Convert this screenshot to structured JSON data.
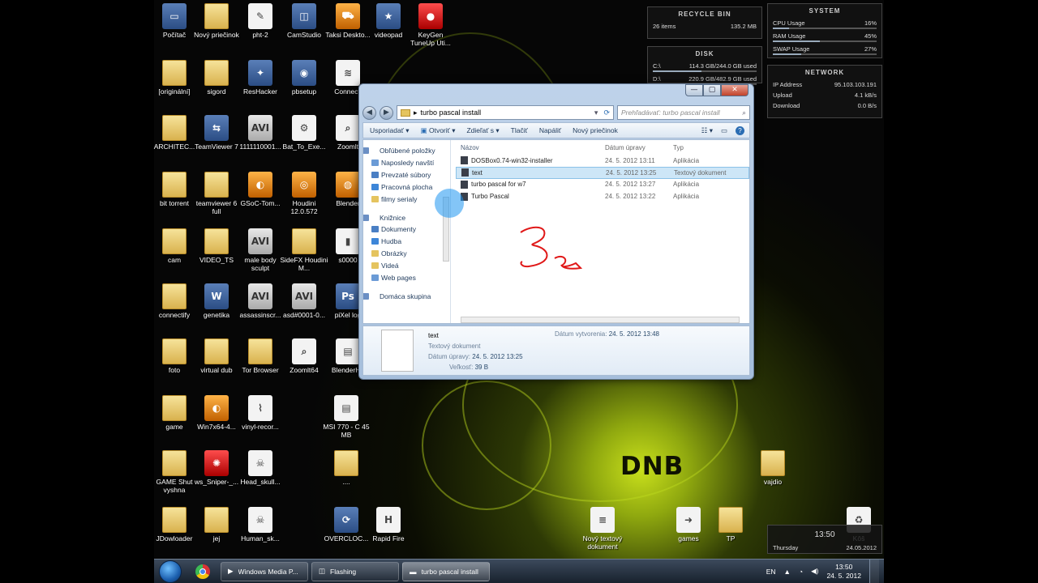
{
  "desktop": {
    "brand_text": "DNB",
    "icons": [
      {
        "label": "Počítač",
        "kind": "app",
        "glyph": "▭"
      },
      {
        "label": "Nový priečinok",
        "kind": "folder",
        "glyph": ""
      },
      {
        "label": "pht-2",
        "kind": "white",
        "glyph": "✎"
      },
      {
        "label": "CamStudio",
        "kind": "app",
        "glyph": "◫"
      },
      {
        "label": "Taksi Deskto...",
        "kind": "orange",
        "glyph": "⛟"
      },
      {
        "label": "videopad",
        "kind": "app",
        "glyph": "★"
      },
      {
        "label": "KeyGen TuneUp Uti...",
        "kind": "red",
        "glyph": "●"
      },
      {
        "label": "[originální]",
        "kind": "folder",
        "glyph": ""
      },
      {
        "label": "sigord",
        "kind": "folder",
        "glyph": ""
      },
      {
        "label": "ResHacker",
        "kind": "app",
        "glyph": "✦"
      },
      {
        "label": "pbsetup",
        "kind": "app",
        "glyph": "◉"
      },
      {
        "label": "Connecti",
        "kind": "white",
        "glyph": "≋"
      },
      {
        "label": "ARCHITEC...",
        "kind": "folder",
        "glyph": ""
      },
      {
        "label": "TeamViewer 7",
        "kind": "app",
        "glyph": "⇆"
      },
      {
        "label": "1111110001...",
        "kind": "film",
        "glyph": "AVI"
      },
      {
        "label": "Bat_To_Exe...",
        "kind": "white",
        "glyph": "⚙"
      },
      {
        "label": "Zoomlt",
        "kind": "white",
        "glyph": "⌕"
      },
      {
        "label": "bit torrent",
        "kind": "folder",
        "glyph": ""
      },
      {
        "label": "teamviewer 6 full",
        "kind": "folder",
        "glyph": ""
      },
      {
        "label": "GSoC-Tom...",
        "kind": "orange",
        "glyph": "◐"
      },
      {
        "label": "Houdini 12.0.572",
        "kind": "orange",
        "glyph": "◎"
      },
      {
        "label": "Blender",
        "kind": "orange",
        "glyph": "◍"
      },
      {
        "label": "cam",
        "kind": "folder",
        "glyph": ""
      },
      {
        "label": "VIDEO_TS",
        "kind": "folder",
        "glyph": ""
      },
      {
        "label": "male body sculpt",
        "kind": "film",
        "glyph": "AVI"
      },
      {
        "label": "SideFX Houdini M...",
        "kind": "folder",
        "glyph": ""
      },
      {
        "label": "s0000",
        "kind": "white",
        "glyph": "▮"
      },
      {
        "label": "connectify",
        "kind": "folder",
        "glyph": ""
      },
      {
        "label": "genetika",
        "kind": "app",
        "glyph": "W"
      },
      {
        "label": "assassinscr...",
        "kind": "film",
        "glyph": "AVI"
      },
      {
        "label": "asd#0001-0...",
        "kind": "film",
        "glyph": "AVI"
      },
      {
        "label": "piXel log",
        "kind": "app",
        "glyph": "Ps"
      },
      {
        "label": "foto",
        "kind": "folder",
        "glyph": ""
      },
      {
        "label": "virtual dub",
        "kind": "folder",
        "glyph": ""
      },
      {
        "label": "Tor Browser",
        "kind": "folder",
        "glyph": ""
      },
      {
        "label": "Zoomlt64",
        "kind": "white",
        "glyph": "⌕"
      },
      {
        "label": "BlenderHe",
        "kind": "white",
        "glyph": "▤"
      },
      {
        "label": "game",
        "kind": "folder",
        "glyph": ""
      },
      {
        "label": "Win7x64-4...",
        "kind": "orange",
        "glyph": "◐"
      },
      {
        "label": "vinyl-recor...",
        "kind": "white",
        "glyph": "⌇"
      },
      {
        "label": "MSI 770 - C 45 MB",
        "kind": "white",
        "glyph": "▤"
      },
      {
        "label": "GAME Shut vyshna",
        "kind": "folder",
        "glyph": ""
      },
      {
        "label": "ws_Sniper-_...",
        "kind": "red",
        "glyph": "✺"
      },
      {
        "label": "Head_skull...",
        "kind": "white",
        "glyph": "☠"
      },
      {
        "label": "....",
        "kind": "folder",
        "glyph": ""
      },
      {
        "label": "vajdio",
        "kind": "folder",
        "glyph": ""
      },
      {
        "label": "JDowloader",
        "kind": "folder",
        "glyph": ""
      },
      {
        "label": "jej",
        "kind": "folder",
        "glyph": ""
      },
      {
        "label": "Human_sk...",
        "kind": "white",
        "glyph": "☠"
      },
      {
        "label": "OVERCLOC...",
        "kind": "app",
        "glyph": "⟳"
      },
      {
        "label": "Rapid Fire",
        "kind": "white",
        "glyph": "H"
      },
      {
        "label": "Nový textový dokument",
        "kind": "white",
        "glyph": "≡"
      },
      {
        "label": "games",
        "kind": "white",
        "glyph": "➜"
      },
      {
        "label": "TP",
        "kind": "folder",
        "glyph": ""
      },
      {
        "label": "Kôš",
        "kind": "white",
        "glyph": "♻"
      }
    ]
  },
  "gadgets": {
    "recycle": {
      "title": "RECYCLE BIN",
      "items": "26 items",
      "size": "135.2 MB"
    },
    "disk": {
      "title": "DISK",
      "rows": [
        {
          "drive": "C:\\",
          "usage": "114.3 GB/244.0 GB used",
          "pct": 47
        },
        {
          "drive": "D:\\",
          "usage": "220.9 GB/482.9 GB used",
          "pct": 46
        }
      ]
    },
    "system": {
      "title": "SYSTEM",
      "rows": [
        {
          "label": "CPU Usage",
          "value": "16%",
          "pct": 16
        },
        {
          "label": "RAM Usage",
          "value": "45%",
          "pct": 45
        },
        {
          "label": "SWAP Usage",
          "value": "27%",
          "pct": 27
        }
      ]
    },
    "network": {
      "title": "NETWORK",
      "rows": [
        {
          "label": "IP Address",
          "value": "95.103.103.191"
        },
        {
          "label": "Upload",
          "value": "4.1 kB/s"
        },
        {
          "label": "Download",
          "value": "0.0 B/s"
        }
      ]
    },
    "clock": {
      "time": "13:50",
      "day": "Thursday",
      "date": "24.05.2012"
    }
  },
  "window": {
    "path": "turbo pascal install",
    "search_placeholder": "Prehľadávať: turbo pascal install",
    "toolbar": {
      "organize": "Usporiadať",
      "open": "Otvoriť",
      "share": "Zdieľať s",
      "print": "Tlačiť",
      "burn": "Napáliť",
      "new_folder": "Nový priečinok"
    },
    "nav": [
      {
        "label": "Obľúbené položky",
        "top": true
      },
      {
        "label": "Naposledy navští",
        "top": false
      },
      {
        "label": "Prevzaté súbory",
        "top": false
      },
      {
        "label": "Pracovná plocha",
        "top": false
      },
      {
        "label": "filmy serialy",
        "top": false
      },
      {
        "gap": true
      },
      {
        "label": "Knižnice",
        "top": true
      },
      {
        "label": "Dokumenty",
        "top": false
      },
      {
        "label": "Hudba",
        "top": false
      },
      {
        "label": "Obrázky",
        "top": false
      },
      {
        "label": "Videá",
        "top": false
      },
      {
        "label": "Web pages",
        "top": false
      },
      {
        "gap": true
      },
      {
        "label": "Domáca skupina",
        "top": true
      }
    ],
    "columns": {
      "name": "Názov",
      "date": "Dátum úpravy",
      "type": "Typ"
    },
    "files": [
      {
        "name": "DOSBox0.74-win32-installer",
        "date": "24. 5. 2012 13:11",
        "type": "Aplikácia",
        "selected": false
      },
      {
        "name": "text",
        "date": "24. 5. 2012 13:25",
        "type": "Textový dokument",
        "selected": true
      },
      {
        "name": "turbo pascal for w7",
        "date": "24. 5. 2012 13:27",
        "type": "Aplikácia",
        "selected": false
      },
      {
        "name": "Turbo Pascal",
        "date": "24. 5. 2012 13:22",
        "type": "Aplikácia",
        "selected": false
      }
    ],
    "details": {
      "name": "text",
      "type": "Textový dokument",
      "modified_label": "Dátum úpravy:",
      "modified": "24. 5. 2012 13:25",
      "size_label": "Veľkosť:",
      "size": "39 B",
      "created_label": "Dátum vytvorenia:",
      "created": "24. 5. 2012 13:48"
    }
  },
  "taskbar": {
    "buttons": [
      {
        "label": "Windows Media P...",
        "active": false
      },
      {
        "label": "Flashing",
        "active": false
      },
      {
        "label": "turbo pascal install",
        "active": true
      }
    ],
    "lang": "EN",
    "time": "13:50",
    "date": "24. 5. 2012"
  },
  "colors": {
    "accent": "#c9e01c",
    "selection": "#cde6f7",
    "annotation": "#e01818"
  }
}
